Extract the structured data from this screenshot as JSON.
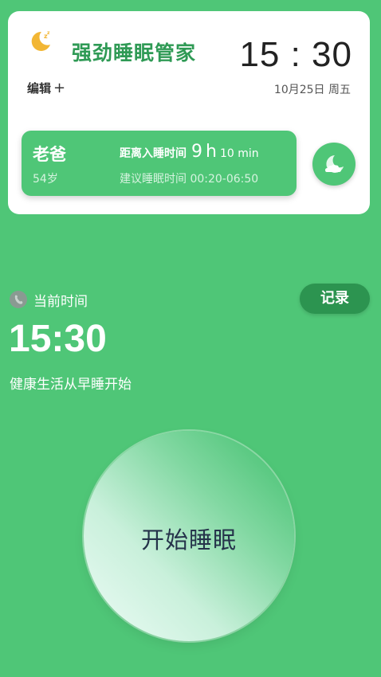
{
  "header": {
    "app_title": "强劲睡眠管家",
    "clock": "15 : 30",
    "date": "10月25日 周五",
    "edit_label": "编辑",
    "edit_plus": "+"
  },
  "member": {
    "name": "老爸",
    "age": "54岁",
    "countdown_label": "距离入睡时间",
    "countdown_hours": "9",
    "countdown_hours_unit": "h",
    "countdown_minutes": "10 min",
    "suggest": "建议睡眠时间 00:20-06:50"
  },
  "now": {
    "label": "当前时间",
    "time": "15:30",
    "slogan": "健康生活从早睡开始",
    "record_button": "记录"
  },
  "sleep_button": {
    "label": "开始睡眠"
  },
  "icons": {
    "logo": "moon-zzz-icon",
    "toggle": "moon-cloud-icon",
    "clock": "clock-icon"
  },
  "colors": {
    "background": "#4fc677",
    "brand_title": "#2f9a55",
    "record_button": "#2c9450",
    "moon": "#f2b634"
  }
}
